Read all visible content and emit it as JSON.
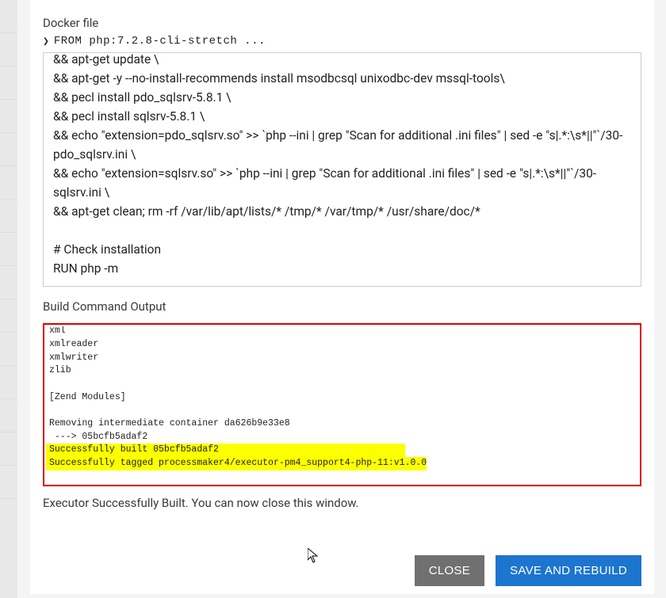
{
  "labels": {
    "dockerfile": "Docker file",
    "dockerfile_summary": "FROM php:7.2.8-cli-stretch ...",
    "build_output": "Build Command Output",
    "status": "Executor Successfully Built. You can now close this window."
  },
  "dockerfile_content": "&& apt-get update \\\n&& apt-get -y --no-install-recommends install msodbcsql unixodbc-dev mssql-tools\\\n&& pecl install pdo_sqlsrv-5.8.1 \\\n&& pecl install sqlsrv-5.8.1 \\\n&& echo \"extension=pdo_sqlsrv.so\" >> `php --ini | grep \"Scan for additional .ini files\" | sed -e \"s|.*:\\s*||\"`/30-pdo_sqlsrv.ini \\\n&& echo \"extension=sqlsrv.so\" >> `php --ini | grep \"Scan for additional .ini files\" | sed -e \"s|.*:\\s*||\"`/30-sqlsrv.ini \\\n&& apt-get clean; rm -rf /var/lib/apt/lists/* /tmp/* /var/tmp/* /usr/share/doc/*\n\n# Check installation\nRUN php -m",
  "output": {
    "plain": "xml\nxmlreader\nxmlwriter\nzlib\n\n[Zend Modules]\n\nRemoving intermediate container da626b9e33e8\n ---> 05bcfb5adaf2",
    "highlight1": "Successfully built 05bcfb5adaf2                                  ",
    "highlight2": "Successfully tagged processmaker4/executor-pm4_support4-php-11:v1.0.0"
  },
  "buttons": {
    "close": "CLOSE",
    "save_rebuild": "SAVE AND REBUILD"
  }
}
